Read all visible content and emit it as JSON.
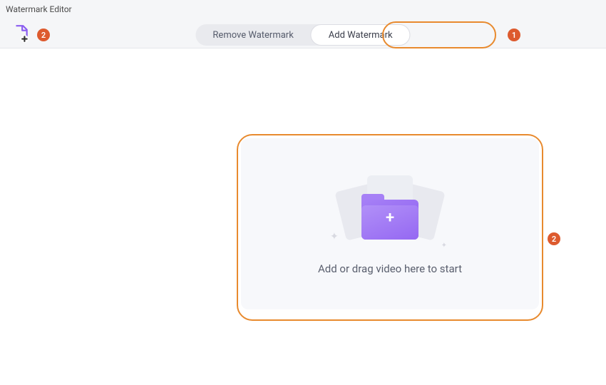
{
  "header": {
    "title": "Watermark Editor",
    "tabs": {
      "remove": "Remove Watermark",
      "add": "Add Watermark"
    }
  },
  "dropzone": {
    "text": "Add or drag video here to start"
  },
  "annotations": {
    "step1": "1",
    "step2": "2"
  },
  "icons": {
    "add_file": "file-add-icon",
    "folder_plus": "folder-plus-icon"
  },
  "colors": {
    "accent_purple": "#9568f2",
    "callout_orange": "#e88a2e",
    "badge_orange": "#dd5a2e"
  }
}
